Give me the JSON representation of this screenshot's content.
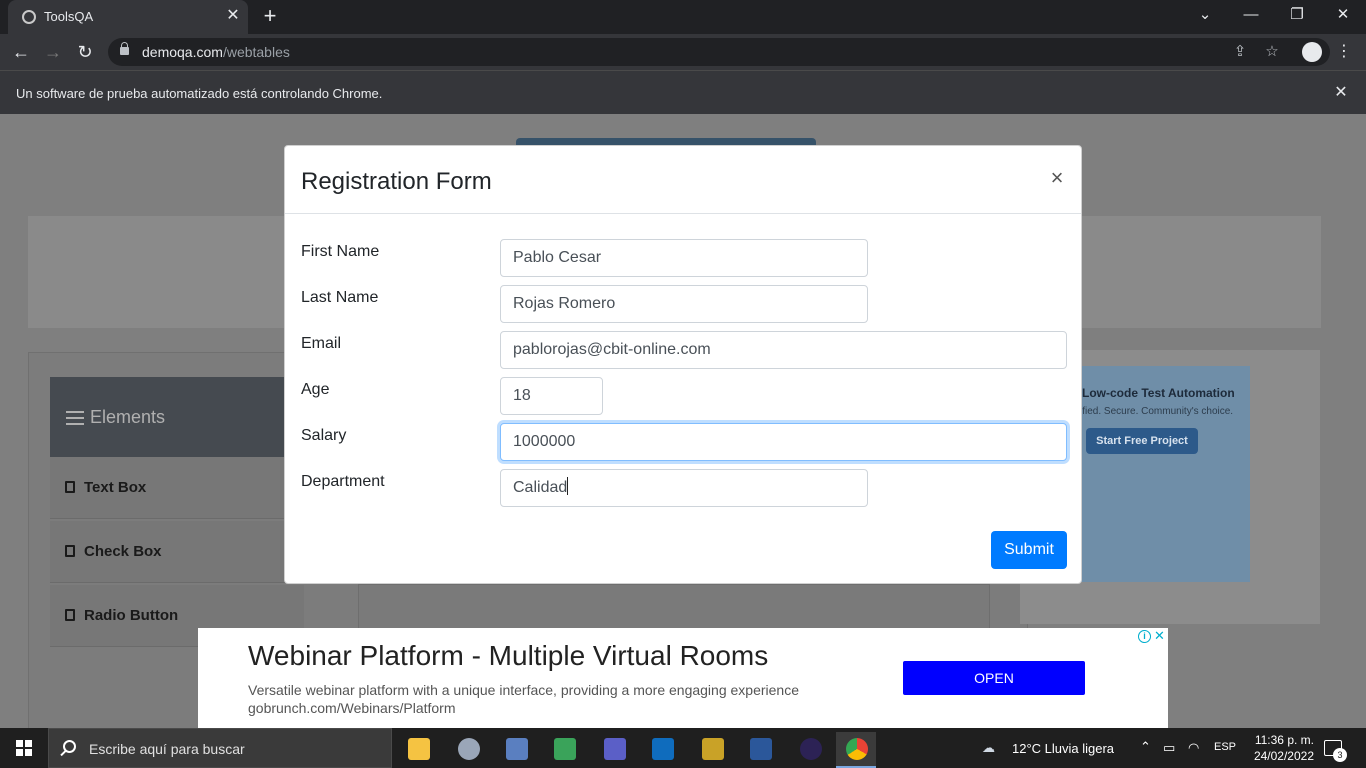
{
  "browser": {
    "tab_title": "ToolsQA",
    "url_domain": "demoqa.com",
    "url_path": "/webtables",
    "info_text": "Un software de prueba automatizado está controlando Chrome."
  },
  "background": {
    "sidebar_header": "Elements",
    "sidebar_items": [
      "Text Box",
      "Check Box",
      "Radio Button"
    ],
    "ad_title": "Low-code Test Automation",
    "ad_subtitle": "ified. Secure. Community's choice.",
    "ad_button": "Start Free Project"
  },
  "modal": {
    "title": "Registration Form",
    "close_label": "×",
    "fields": [
      {
        "label": "First Name",
        "value": "Pablo Cesar"
      },
      {
        "label": "Last Name",
        "value": "Rojas Romero"
      },
      {
        "label": "Email",
        "value": "pablorojas@cbit-online.com"
      },
      {
        "label": "Age",
        "value": "18"
      },
      {
        "label": "Salary",
        "value": "1000000"
      },
      {
        "label": "Department",
        "value": "Calidad"
      }
    ],
    "submit_label": "Submit"
  },
  "bottom_ad": {
    "headline": "Webinar Platform - Multiple Virtual Rooms",
    "description": "Versatile webinar platform with a unique interface, providing a more engaging experience",
    "url": "gobrunch.com/Webinars/Platform",
    "button_label": "OPEN"
  },
  "taskbar": {
    "search_placeholder": "Escribe aquí para buscar",
    "weather": "12°C  Lluvia ligera",
    "language": "ESP",
    "time": "11:36 p. m.",
    "date": "24/02/2022",
    "notification_count": "3"
  },
  "colors": {
    "submit": "#007bff",
    "ad_open": "#0000ff",
    "focus_ring": "#80bdff"
  }
}
